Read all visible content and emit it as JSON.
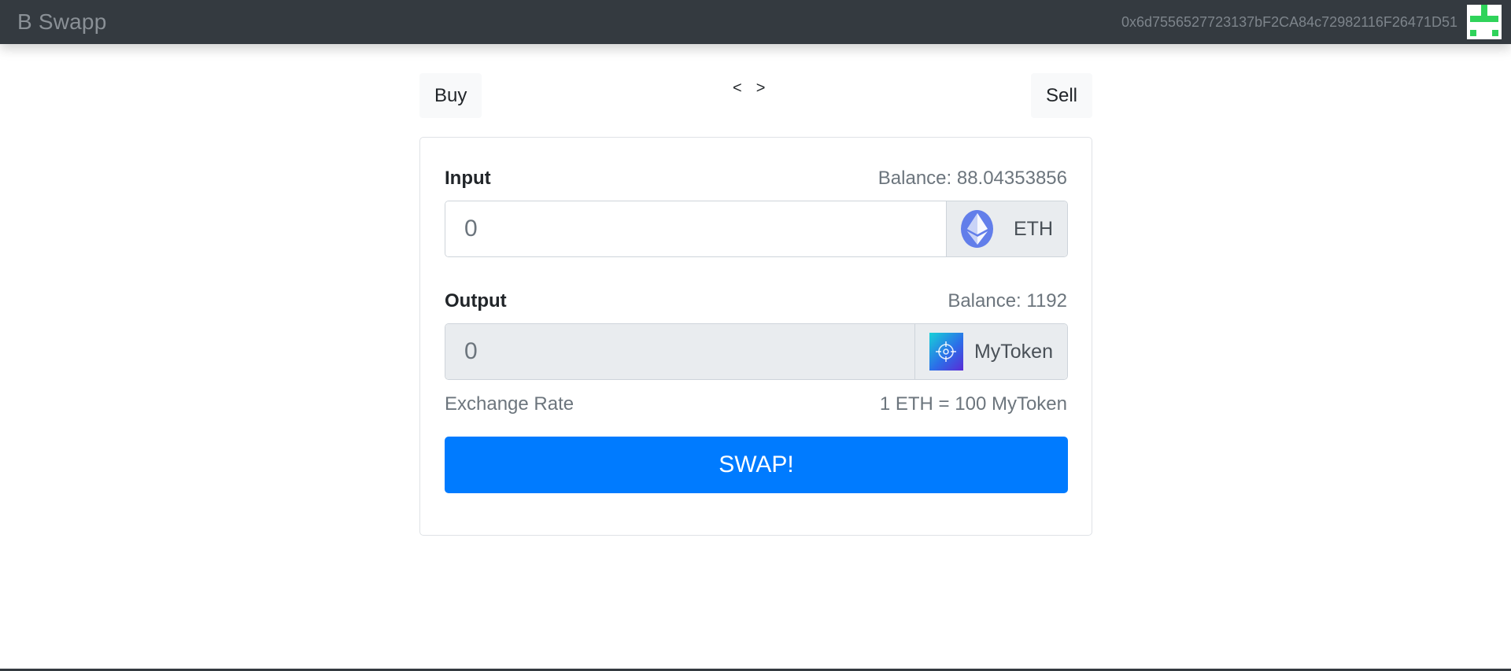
{
  "navbar": {
    "brand": "B Swapp",
    "account_address": "0x6d7556527723137bF2CA84c72982116F26471D51",
    "avatar_icon": "identicon-avatar",
    "background": "#343a40"
  },
  "toolbar": {
    "buy_label": "Buy",
    "sell_label": "Sell",
    "prev_label": "<",
    "next_label": ">"
  },
  "form": {
    "input": {
      "label": "Input",
      "balance": "Balance: 88.04353856",
      "placeholder": "0",
      "token": "ETH",
      "token_icon": "ethereum-icon"
    },
    "output": {
      "label": "Output",
      "balance": "Balance: 1192",
      "placeholder": "0",
      "token": "MyToken",
      "token_icon": "mytoken-icon"
    },
    "exchange_rate_label": "Exchange Rate",
    "exchange_rate_value": "1 ETH = 100 MyToken",
    "swap_label": "SWAP!",
    "accent_color": "#007bff"
  }
}
